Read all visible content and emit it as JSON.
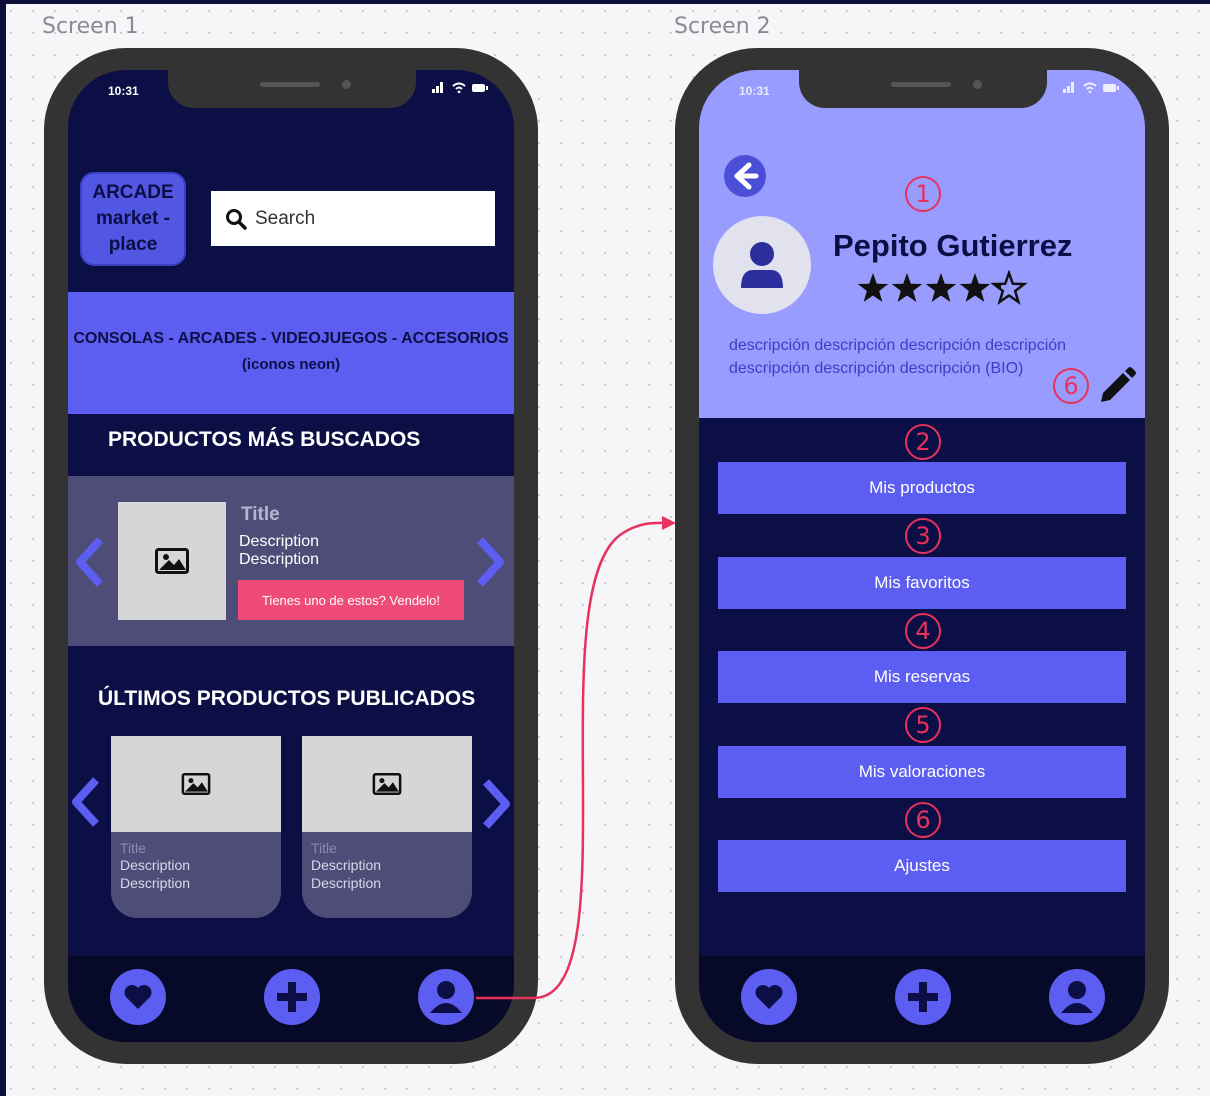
{
  "labels": {
    "screen1": "Screen 1",
    "screen2": "Screen 2"
  },
  "status": {
    "time": "10:31"
  },
  "screen1": {
    "logo": {
      "line1": "ARCADE",
      "line2": "market -",
      "line3": "place"
    },
    "search": {
      "placeholder": "Search"
    },
    "banner": {
      "categories": "CONSOLAS - ARCADES - VIDEOJUEGOS - ACCESORIOS",
      "note": "(iconos neon)"
    },
    "most_searched_title": "PRODUCTOS MÁS BUSCADOS",
    "featured": {
      "title": "Title",
      "desc1": "Description",
      "desc2": "Description",
      "sell_button": "Tienes uno de estos? Vendelo!"
    },
    "latest_title": "ÚLTIMOS PRODUCTOS PUBLICADOS",
    "cards": [
      {
        "title": "Title",
        "desc1": "Description",
        "desc2": "Description"
      },
      {
        "title": "Title",
        "desc1": "Description",
        "desc2": "Description"
      }
    ]
  },
  "screen2": {
    "name": "Pepito Gutierrez",
    "rating": 4.5,
    "bio_line1": "descripción descripción descripción descripción",
    "bio_line2": "descripción descripción descripción (BIO)",
    "annotations": {
      "n1": "1",
      "n2": "2",
      "n3": "3",
      "n4": "4",
      "n5": "5",
      "n6a": "6",
      "n6b": "6"
    },
    "menu": [
      "Mis productos",
      "Mis favoritos",
      "Mis reservas",
      "Mis valoraciones",
      "Ajustes"
    ]
  },
  "colors": {
    "navy": "#0c0f45",
    "accent": "#5b5ef0",
    "light_header": "#999cff",
    "pink": "#ee4b78",
    "annotation": "#e8315c"
  },
  "icons": [
    "search-icon",
    "image-icon",
    "chevron-left-icon",
    "chevron-right-icon",
    "heart-icon",
    "plus-icon",
    "user-icon",
    "back-arrow-icon",
    "star-icon",
    "pencil-icon"
  ]
}
